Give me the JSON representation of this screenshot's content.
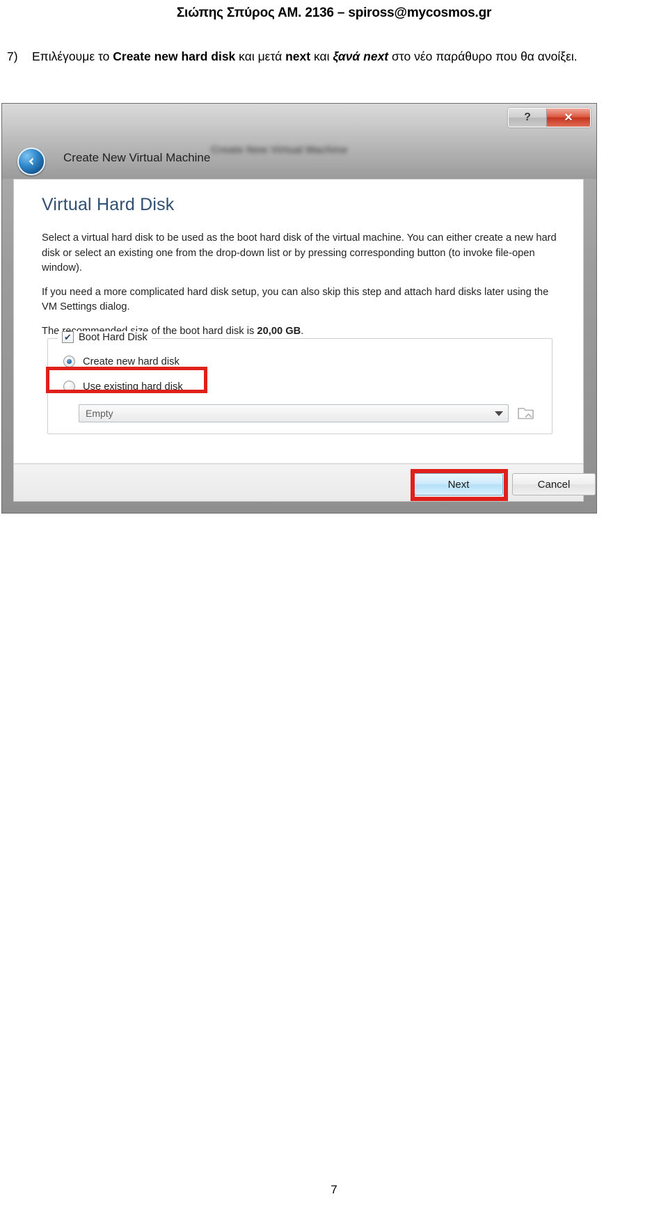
{
  "document": {
    "header": "Σιώπης Σπύρος ΑΜ. 2136 – spiross@mycosmos.gr",
    "page_number": "7",
    "instruction": {
      "number": "7)",
      "part1": "Επιλέγουμε το ",
      "bold1": "Create new hard disk",
      "part2": " και μετά ",
      "bold2": "next",
      "part3": " και ",
      "bolditalic3": "ξανά next",
      "part4": " στο νέο παράθυρο που θα ανοίξει."
    }
  },
  "screenshot": {
    "window": {
      "ghost_title": "Create New Virtual Machine",
      "help_button": "?",
      "close_button": "✕",
      "back_button_icon": "back-arrow-icon",
      "wizard_header": "Create New Virtual Machine"
    },
    "panel": {
      "heading": "Virtual Hard Disk",
      "paragraph1": "Select a virtual hard disk to be used as the boot hard disk of the virtual machine. You can either create a new hard disk or select an existing one from the drop-down list or by pressing corresponding button (to invoke file-open window).",
      "paragraph2": "If you need a more complicated hard disk setup, you can also skip this step and attach hard disks later using the VM Settings dialog.",
      "paragraph3_prefix": "The recommended size of the boot hard disk is ",
      "paragraph3_value": "20,00 GB",
      "paragraph3_suffix": "."
    },
    "group": {
      "legend": "Boot Hard Disk",
      "legend_checked": true,
      "options": [
        {
          "label": "Create new hard disk",
          "selected": true
        },
        {
          "label": "Use existing hard disk",
          "selected": false
        }
      ],
      "combo_value": "Empty",
      "browse_icon": "folder-open-icon"
    },
    "footer": {
      "next_label": "Next",
      "cancel_label": "Cancel"
    },
    "annotations": {
      "highlight_color": "#e0211b",
      "highlighted_items": [
        "Create new hard disk",
        "Next"
      ]
    }
  }
}
